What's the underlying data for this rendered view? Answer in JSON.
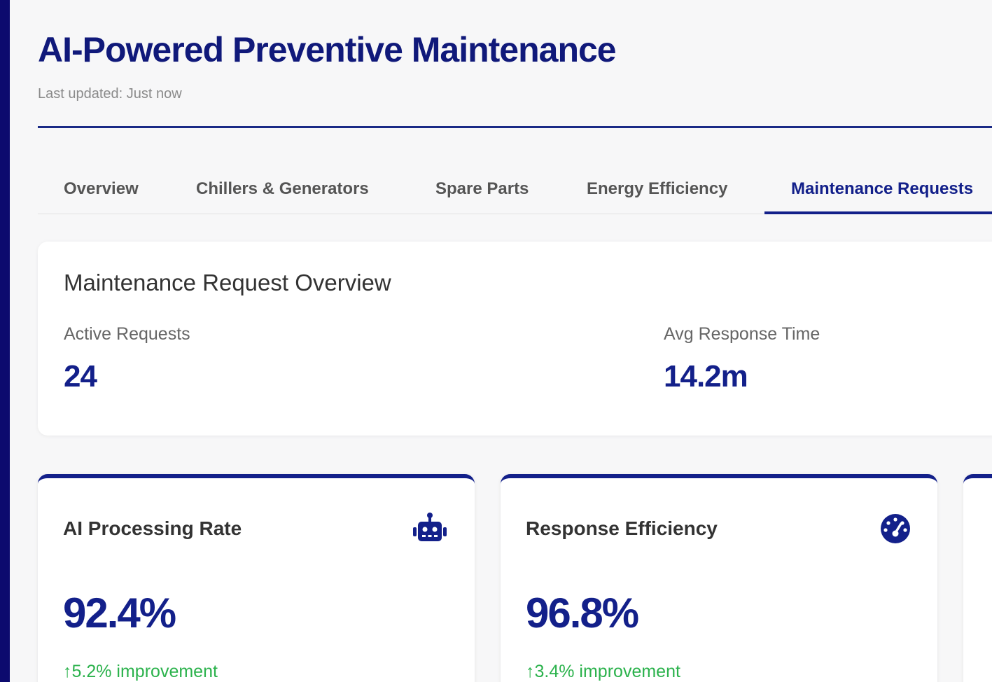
{
  "header": {
    "title": "AI-Powered Preventive Maintenance",
    "last_updated": "Last updated: Just now"
  },
  "tabs": [
    {
      "label": "Overview"
    },
    {
      "label": "Chillers & Generators"
    },
    {
      "label": "Spare Parts"
    },
    {
      "label": "Energy Efficiency"
    },
    {
      "label": "Maintenance Requests",
      "active": true
    }
  ],
  "overview": {
    "title": "Maintenance Request Overview",
    "stats": [
      {
        "label": "Active Requests",
        "value": "24"
      },
      {
        "label": "Avg Response Time",
        "value": "14.2m"
      }
    ]
  },
  "metrics": [
    {
      "title": "AI Processing Rate",
      "value": "92.4%",
      "trend_arrow": "↑",
      "trend": "5.2% improvement",
      "icon": "robot-icon"
    },
    {
      "title": "Response Efficiency",
      "value": "96.8%",
      "trend_arrow": "↑",
      "trend": "3.4% improvement",
      "icon": "gauge-icon"
    }
  ],
  "colors": {
    "primary": "#13208a",
    "frame": "#0c0a6e",
    "positive": "#2bb24c"
  }
}
